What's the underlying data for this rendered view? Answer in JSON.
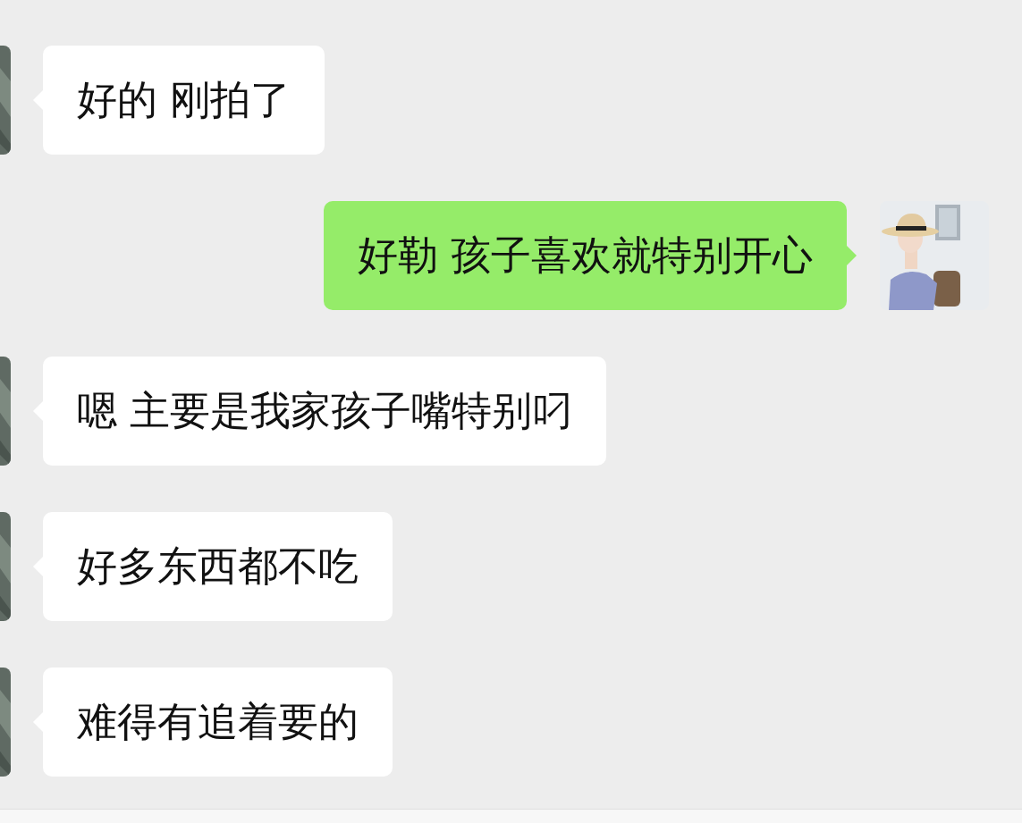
{
  "messages": [
    {
      "kind": "received",
      "text": "好的 刚拍了"
    },
    {
      "kind": "sent",
      "text": "好勒 孩子喜欢就特别开心"
    },
    {
      "kind": "received",
      "text": "嗯 主要是我家孩子嘴特别叼"
    },
    {
      "kind": "received",
      "text": "好多东西都不吃"
    },
    {
      "kind": "received",
      "text": "难得有追着要的"
    }
  ]
}
